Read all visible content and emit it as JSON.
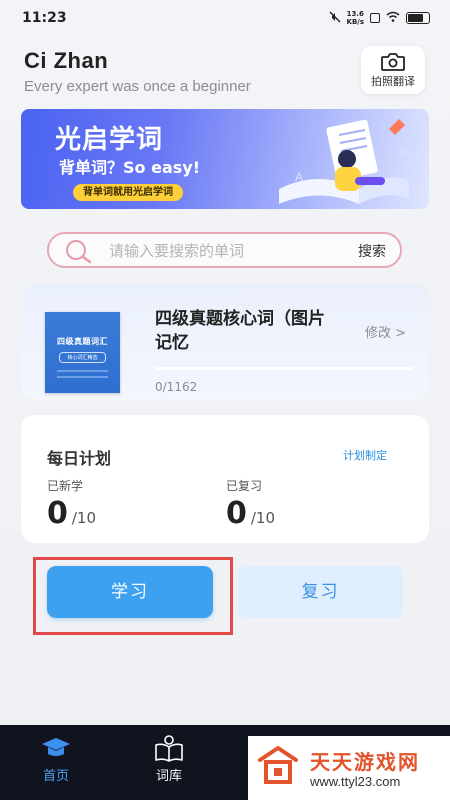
{
  "status_bar": {
    "time": "11:23",
    "speed_value": "13.6",
    "speed_unit": "KB/s"
  },
  "header": {
    "title": "Ci Zhan",
    "subtitle": "Every expert was once a beginner",
    "photo_translate_label": "拍照翻译"
  },
  "banner": {
    "title": "光启学词",
    "subtitle": "背单词？So easy!",
    "tag": "背单词就用光启学词"
  },
  "search": {
    "placeholder": "请输入要搜索的单词",
    "button_label": "搜索"
  },
  "current_book": {
    "title": "四级真题核心词（图片记忆",
    "edit_label": "修改 >",
    "progress_text": "0/1162",
    "progress_fraction": 0,
    "cover": {
      "title": "四级真题词汇",
      "tag": "核心词汇精选"
    }
  },
  "daily_plan": {
    "title": "每日计划",
    "set_plan_label": "计划制定",
    "new_label": "已新学",
    "new_value": "0",
    "new_total": "/10",
    "review_label": "已复习",
    "review_value": "0",
    "review_total": "/10"
  },
  "actions": {
    "study_label": "学习",
    "review_label": "复习"
  },
  "tabbar": {
    "home_label": "首页",
    "library_label": "词库"
  },
  "watermark": {
    "name": "天天游戏网",
    "url": "www.ttyl23.com"
  },
  "colors": {
    "accent": "#3da1f0",
    "highlight": "#e24a4a",
    "tabbar_bg": "#10141f"
  }
}
